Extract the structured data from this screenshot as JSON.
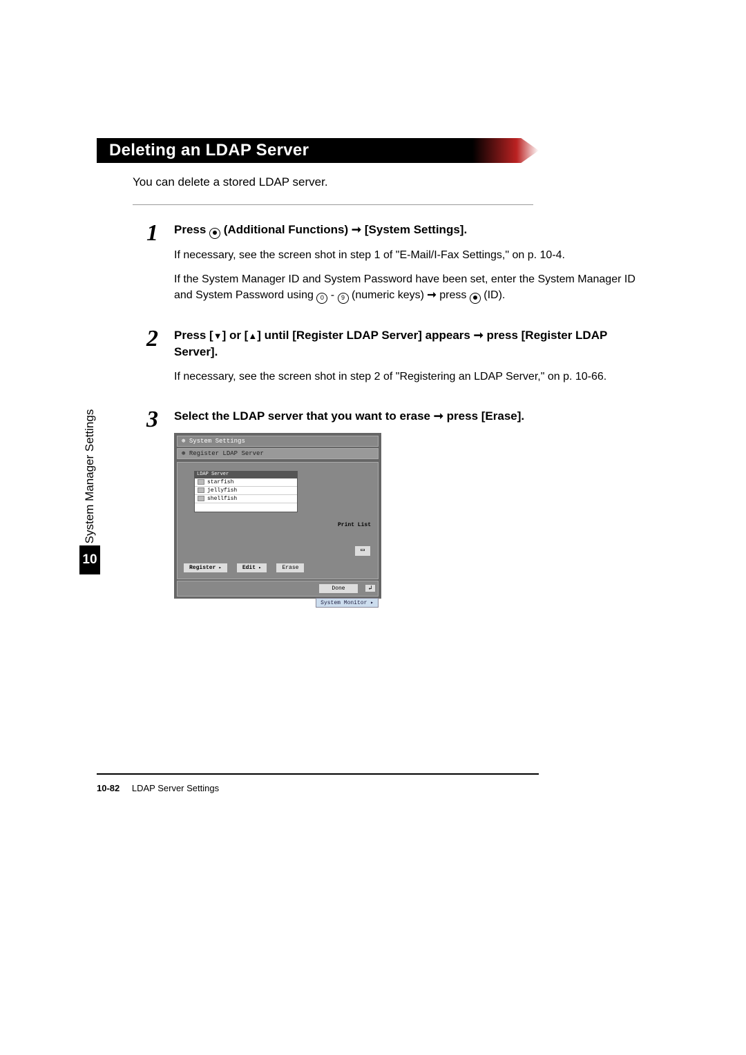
{
  "heading": "Deleting an LDAP Server",
  "intro": "You can delete a stored LDAP server.",
  "side": {
    "label": "System Manager Settings",
    "chapter": "10"
  },
  "steps": {
    "s1": {
      "num": "1",
      "title_pre": "Press ",
      "title_mid": " (Additional Functions) ",
      "arrow": "➞",
      "title_post": " [System Settings].",
      "body1": "If necessary, see the screen shot in step 1 of \"E-Mail/I-Fax Settings,\" on p. 10-4.",
      "body2a": "If the System Manager ID and System Password have been set, enter the System Manager ID and System Password using ",
      "key0": "0",
      "dash": " - ",
      "key9": "9",
      "body2b": " (numeric keys) ",
      "body2c": " press ",
      "body2d": " (ID)."
    },
    "s2": {
      "num": "2",
      "title_a": "Press [",
      "tri_down": "▼",
      "title_b": "] or [",
      "tri_up": "▲",
      "title_c": "] until [Register LDAP Server] appears ",
      "arrow": "➞",
      "title_d": " press [Register LDAP Server].",
      "body": "If necessary, see the screen shot in step 2 of \"Registering an LDAP Server,\" on p. 10-66."
    },
    "s3": {
      "num": "3",
      "title_a": "Select the LDAP server that you want to erase ",
      "arrow": "➞",
      "title_b": " press [Erase]."
    }
  },
  "screenshot": {
    "title": "System Settings",
    "subtitle": "Register LDAP Server",
    "list_label": "LDAP Server",
    "rows": [
      "starfish",
      "jellyfish",
      "shellfish"
    ],
    "print": "Print List",
    "btn_register": "Register",
    "btn_edit": "Edit",
    "btn_erase": "Erase",
    "done": "Done",
    "monitor": "System Monitor"
  },
  "footer": {
    "page": "10-82",
    "section": "LDAP Server Settings"
  }
}
